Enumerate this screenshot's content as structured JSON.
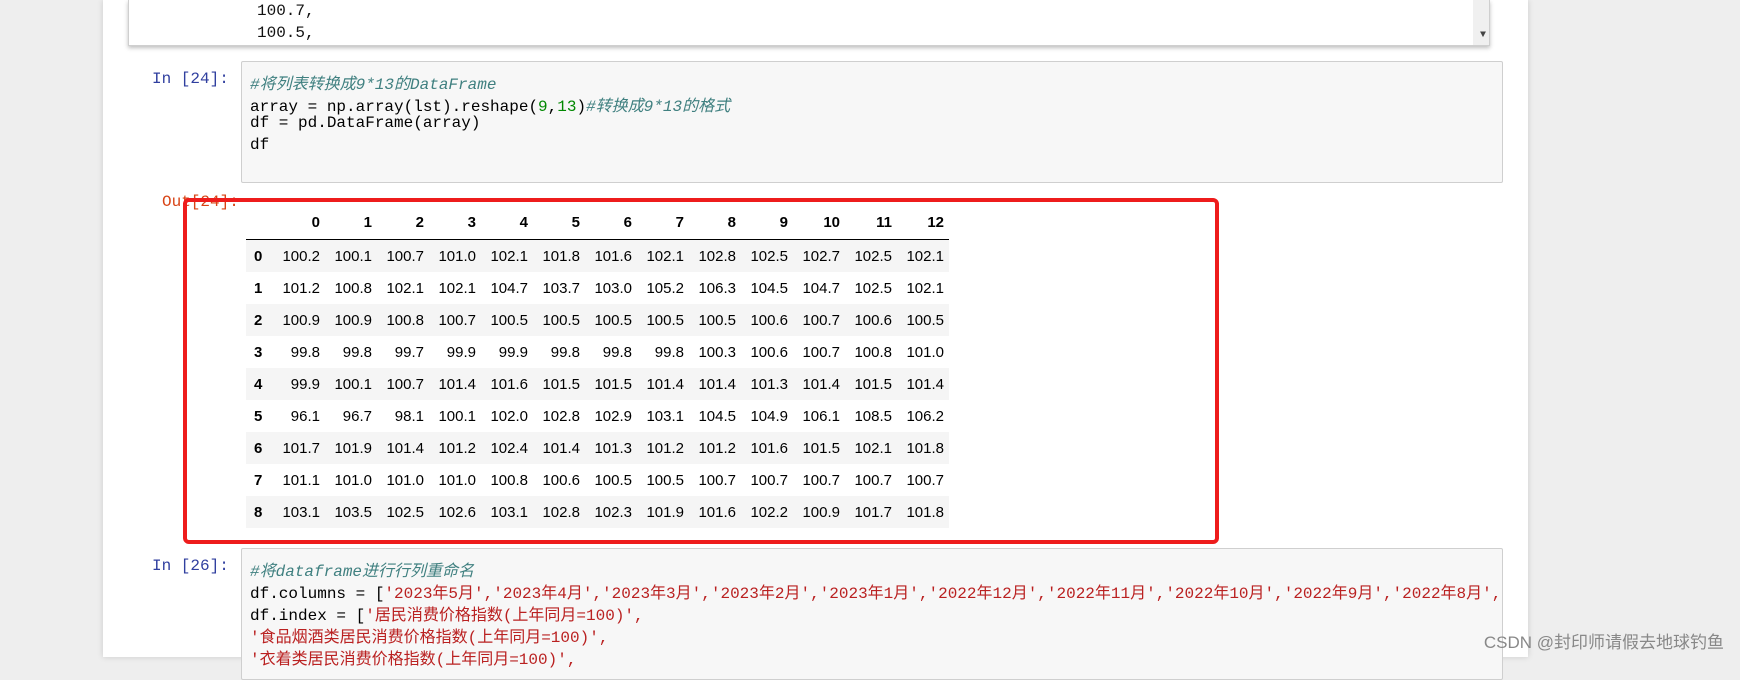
{
  "prev_output": {
    "lines": [
      "100.7,",
      "100.5,"
    ]
  },
  "cell24": {
    "in_prompt": "In  [24]:",
    "comment": "#将列表转换成9*13的DataFrame",
    "line2_a": "array = np.array(lst).reshape(",
    "line2_n1": "9",
    "line2_comma": ",",
    "line2_n2": "13",
    "line2_close": ")",
    "line2_comment": "#转换成9*13的格式",
    "line3": "df = pd.DataFrame(array)",
    "line4": "df",
    "out_prompt": "Out[24]:"
  },
  "dataframe": {
    "columns": [
      "0",
      "1",
      "2",
      "3",
      "4",
      "5",
      "6",
      "7",
      "8",
      "9",
      "10",
      "11",
      "12"
    ],
    "rows": [
      {
        "index": "0",
        "values": [
          "100.2",
          "100.1",
          "100.7",
          "101.0",
          "102.1",
          "101.8",
          "101.6",
          "102.1",
          "102.8",
          "102.5",
          "102.7",
          "102.5",
          "102.1"
        ]
      },
      {
        "index": "1",
        "values": [
          "101.2",
          "100.8",
          "102.1",
          "102.1",
          "104.7",
          "103.7",
          "103.0",
          "105.2",
          "106.3",
          "104.5",
          "104.7",
          "102.5",
          "102.1"
        ]
      },
      {
        "index": "2",
        "values": [
          "100.9",
          "100.9",
          "100.8",
          "100.7",
          "100.5",
          "100.5",
          "100.5",
          "100.5",
          "100.5",
          "100.6",
          "100.7",
          "100.6",
          "100.5"
        ]
      },
      {
        "index": "3",
        "values": [
          "99.8",
          "99.8",
          "99.7",
          "99.9",
          "99.9",
          "99.8",
          "99.8",
          "99.8",
          "100.3",
          "100.6",
          "100.7",
          "100.8",
          "101.0"
        ]
      },
      {
        "index": "4",
        "values": [
          "99.9",
          "100.1",
          "100.7",
          "101.4",
          "101.6",
          "101.5",
          "101.5",
          "101.4",
          "101.4",
          "101.3",
          "101.4",
          "101.5",
          "101.4"
        ]
      },
      {
        "index": "5",
        "values": [
          "96.1",
          "96.7",
          "98.1",
          "100.1",
          "102.0",
          "102.8",
          "102.9",
          "103.1",
          "104.5",
          "104.9",
          "106.1",
          "108.5",
          "106.2"
        ]
      },
      {
        "index": "6",
        "values": [
          "101.7",
          "101.9",
          "101.4",
          "101.2",
          "102.4",
          "101.4",
          "101.3",
          "101.2",
          "101.2",
          "101.6",
          "101.5",
          "102.1",
          "101.8"
        ]
      },
      {
        "index": "7",
        "values": [
          "101.1",
          "101.0",
          "101.0",
          "101.0",
          "100.8",
          "100.6",
          "100.5",
          "100.5",
          "100.7",
          "100.7",
          "100.7",
          "100.7",
          "100.7"
        ]
      },
      {
        "index": "8",
        "values": [
          "103.1",
          "103.5",
          "102.5",
          "102.6",
          "103.1",
          "102.8",
          "102.3",
          "101.9",
          "101.6",
          "102.2",
          "100.9",
          "101.7",
          "101.8"
        ]
      }
    ]
  },
  "cell26": {
    "in_prompt": "In  [26]:",
    "comment": "#将dataframe进行行列重命名",
    "line2_a": "df.columns = [",
    "line2_str": "'2023年5月','2023年4月','2023年3月','2023年2月','2023年1月','2022年12月','2022年11月','2022年10月','2022年9月','2022年8月','2",
    "line3_a": "df.index = [",
    "line3_str": "'居民消费价格指数(上年同月=100)',",
    "line4_str": "'食品烟酒类居民消费价格指数(上年同月=100)',",
    "line5_str": "'衣着类居民消费价格指数(上年同月=100)',"
  },
  "watermark": "CSDN @封印师请假去地球钓鱼",
  "colors": {
    "highlight": "#ee1c1c",
    "in_prompt": "#303f9f",
    "out_prompt": "#d84315"
  }
}
